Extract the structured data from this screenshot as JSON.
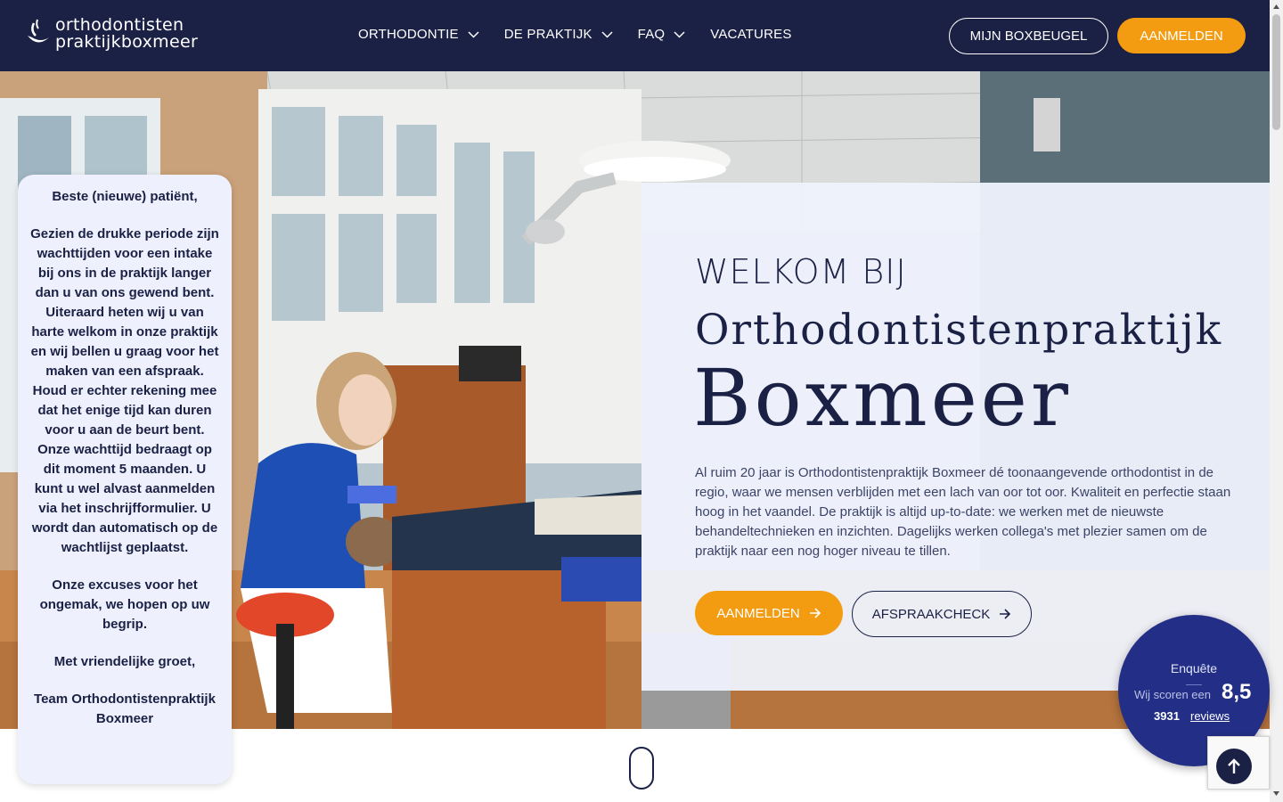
{
  "header": {
    "logo_line1": "orthodontisten",
    "logo_line2": "praktijkboxmeer",
    "nav": [
      {
        "label": "ORTHODONTIE",
        "has_dropdown": true
      },
      {
        "label": "DE PRAKTIJK",
        "has_dropdown": true
      },
      {
        "label": "FAQ",
        "has_dropdown": true
      },
      {
        "label": "VACATURES",
        "has_dropdown": false
      }
    ],
    "my_brace_label": "MIJN BOXBEUGEL",
    "signup_label": "AANMELDEN"
  },
  "notice": {
    "greeting": "Beste (nieuwe) patiënt,",
    "body": "Gezien de drukke periode zijn wachttijden voor een intake bij ons in de praktijk langer dan u van ons gewend bent. Uiteraard heten wij u van harte welkom in onze praktijk en wij bellen u graag voor het maken van een afspraak. Houd er echter rekening mee dat het enige tijd kan duren voor u aan de beurt bent. Onze wachttijd bedraagt op dit moment 5 maanden. U kunt u wel alvast aanmelden via het inschrijfformulier. U wordt dan automatisch op de wachtlijst geplaatst.",
    "apology": "Onze excuses voor het ongemak, we hopen op uw begrip.",
    "closing": "Met vriendelijke groet,",
    "signature": "Team Orthodontistenpraktijk Boxmeer"
  },
  "welcome": {
    "intro": "WELKOM BIJ",
    "name_line1": "Orthodontistenpraktijk",
    "name_line2": "Boxmeer",
    "body": "Al ruim 20 jaar is Orthodontistenpraktijk Boxmeer dé toonaangevende orthodontist in de regio, waar we mensen verblijden met een lach van oor tot oor. Kwaliteit en perfectie staan hoog in het vaandel. De praktijk is altijd up-to-date: we werken met de nieuwste behandeltechnieken en inzichten. Dagelijks werken collega's met plezier samen om de praktijk naar een nog hoger niveau te tillen.",
    "cta_signup": "AANMELDEN",
    "cta_check": "AFSPRAAKCHECK"
  },
  "rating": {
    "label": "Enquête",
    "score_prefix": "Wij scoren een",
    "score": "8,5",
    "count": "3931",
    "reviews_label": "reviews"
  },
  "colors": {
    "navy": "#1b2145",
    "orange": "#f39c12",
    "rating_blue": "#232f86",
    "notice_bg": "#eef1fd"
  }
}
